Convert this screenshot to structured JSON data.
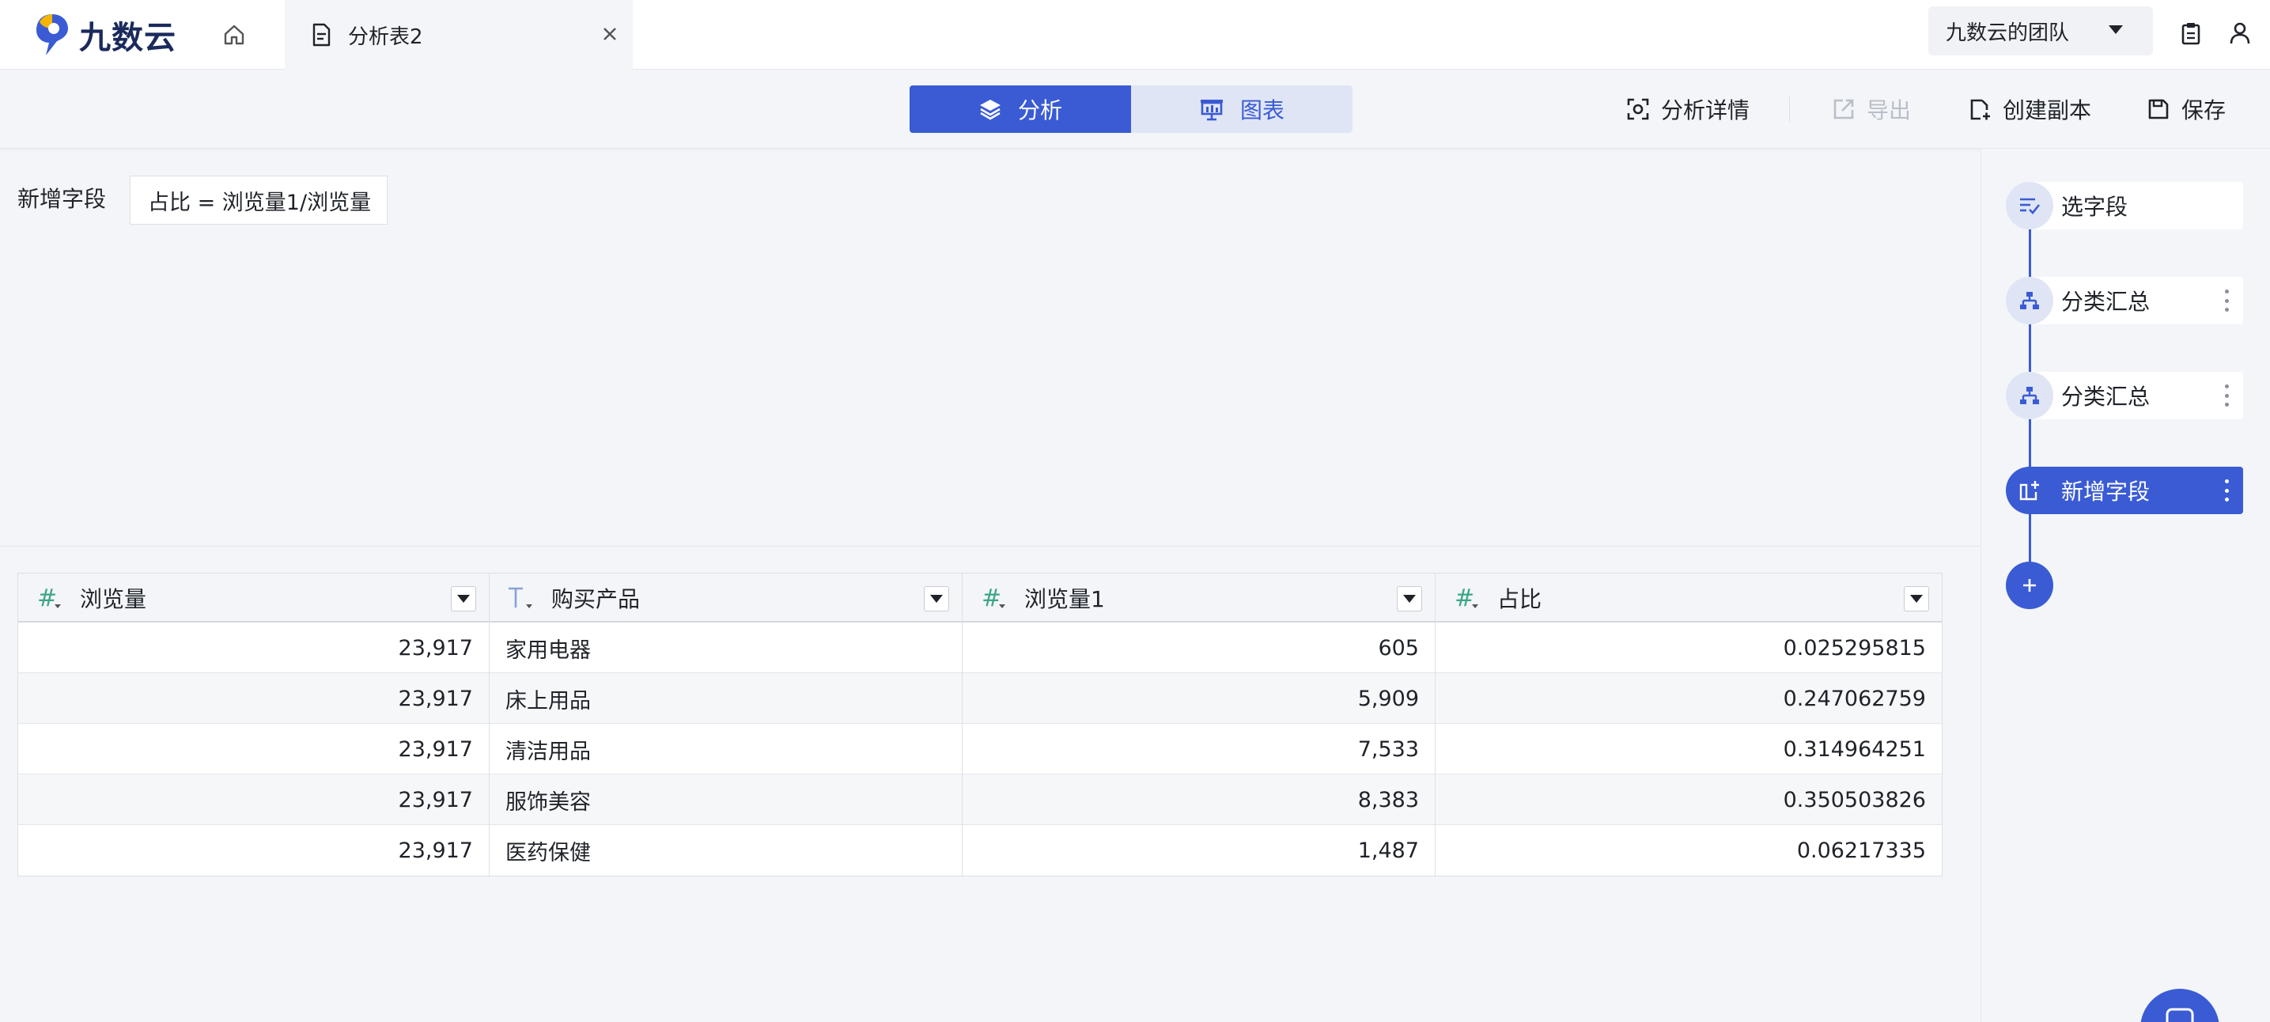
{
  "app": {
    "name": "九数云",
    "brand_color": "#3a5bd3",
    "logo_colors": [
      "#f4b400",
      "#3a5bd3"
    ]
  },
  "topbar": {
    "home_icon": "home-icon",
    "tab": {
      "title": "分析表2",
      "icon": "document-icon",
      "close_icon": "close-icon"
    },
    "team": {
      "label": "九数云的团队"
    },
    "icons": [
      "clipboard-icon",
      "user-icon"
    ]
  },
  "toolbar": {
    "segments": {
      "analysis": "分析",
      "chart": "图表"
    },
    "actions": {
      "details": "分析详情",
      "export": "导出",
      "copy": "创建副本",
      "save": "保存"
    }
  },
  "field": {
    "label": "新增字段",
    "formula": "占比 = 浏览量1/浏览量"
  },
  "table": {
    "columns": [
      {
        "name": "浏览量",
        "type": "number"
      },
      {
        "name": "购买产品",
        "type": "text"
      },
      {
        "name": "浏览量1",
        "type": "number"
      },
      {
        "name": "占比",
        "type": "number"
      }
    ],
    "rows": [
      [
        "23,917",
        "家用电器",
        "605",
        "0.025295815"
      ],
      [
        "23,917",
        "床上用品",
        "5,909",
        "0.247062759"
      ],
      [
        "23,917",
        "清洁用品",
        "7,533",
        "0.314964251"
      ],
      [
        "23,917",
        "服饰美容",
        "8,383",
        "0.350503826"
      ],
      [
        "23,917",
        "医药保健",
        "1,487",
        "0.06217335"
      ]
    ]
  },
  "steps": [
    {
      "label": "选字段",
      "icon": "select-fields-icon",
      "active": false
    },
    {
      "label": "分类汇总",
      "icon": "group-summary-icon",
      "active": false
    },
    {
      "label": "分类汇总",
      "icon": "group-summary-icon",
      "active": false
    },
    {
      "label": "新增字段",
      "icon": "add-field-icon",
      "active": true
    }
  ]
}
